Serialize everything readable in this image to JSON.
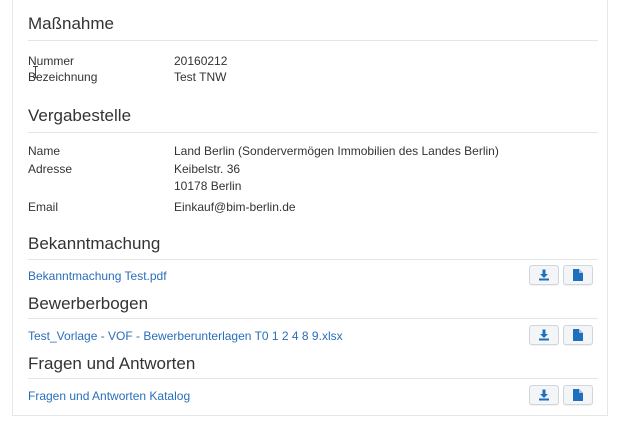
{
  "massnahme": {
    "heading": "Maßnahme",
    "rows": [
      {
        "label": "Nummer",
        "value": "20160212"
      },
      {
        "label": "Bezeichnung",
        "value": "Test TNW"
      }
    ]
  },
  "vergabestelle": {
    "heading": "Vergabestelle",
    "name_label": "Name",
    "name_value": "Land Berlin (Sondervermögen Immobilien des Landes Berlin)",
    "address_label": "Adresse",
    "address_line1": "Keibelstr. 36",
    "address_line2": "10178 Berlin",
    "email_label": "Email",
    "email_value": "Einkauf@bim-berlin.de"
  },
  "sections": [
    {
      "heading": "Bekanntmachung",
      "file": "Bekanntmachung Test.pdf"
    },
    {
      "heading": "Bewerberbogen",
      "file": "Test_Vorlage - VOF - Bewerberunterlagen T0 1 2 4 8 9.xlsx"
    },
    {
      "heading": "Fragen und Antworten",
      "file": "Fragen und Antworten Katalog"
    }
  ],
  "icons": {
    "download": "download-icon",
    "document": "document-icon"
  },
  "colors": {
    "link": "#2a6ebb",
    "icon": "#1f6fbd"
  }
}
